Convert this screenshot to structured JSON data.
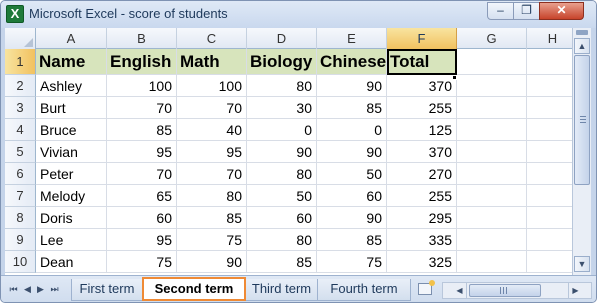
{
  "window": {
    "title": "Microsoft Excel - score of students",
    "app_icon_glyph": "X",
    "minimize_glyph": "–",
    "maximize_glyph": "❐",
    "close_glyph": "✕"
  },
  "sheet": {
    "columns": [
      "A",
      "B",
      "C",
      "D",
      "E",
      "F",
      "G",
      "H"
    ],
    "active_column": "F",
    "active_row": "1",
    "selected_cell": "F1",
    "row_numbers": [
      "1",
      "2",
      "3",
      "4",
      "5",
      "6",
      "7",
      "8",
      "9",
      "10"
    ],
    "header": [
      "Name",
      "English",
      "Math",
      "Biology",
      "Chinese",
      "Total"
    ],
    "rows": [
      [
        "Ashley",
        "100",
        "100",
        "80",
        "90",
        "370"
      ],
      [
        "Burt",
        "70",
        "70",
        "30",
        "85",
        "255"
      ],
      [
        "Bruce",
        "85",
        "40",
        "0",
        "0",
        "125"
      ],
      [
        "Vivian",
        "95",
        "95",
        "90",
        "90",
        "370"
      ],
      [
        "Peter",
        "70",
        "70",
        "80",
        "50",
        "270"
      ],
      [
        "Melody",
        "65",
        "80",
        "50",
        "60",
        "255"
      ],
      [
        "Doris",
        "60",
        "85",
        "60",
        "90",
        "295"
      ],
      [
        "Lee",
        "95",
        "75",
        "80",
        "85",
        "335"
      ],
      [
        "Dean",
        "75",
        "90",
        "85",
        "75",
        "325"
      ]
    ],
    "header_fill_color": "#d7e4bc"
  },
  "tabs": {
    "items": [
      "First term",
      "Second term",
      "Third term",
      "Fourth term"
    ],
    "active": "Second term",
    "active_border_color": "#ef8a35"
  },
  "icons": {
    "nav_first": "⏮",
    "nav_prev": "◀",
    "nav_next": "▶",
    "nav_last": "⏭",
    "scroll_up": "▲",
    "scroll_down": "▼",
    "scroll_left": "◀",
    "scroll_right": "▶"
  }
}
